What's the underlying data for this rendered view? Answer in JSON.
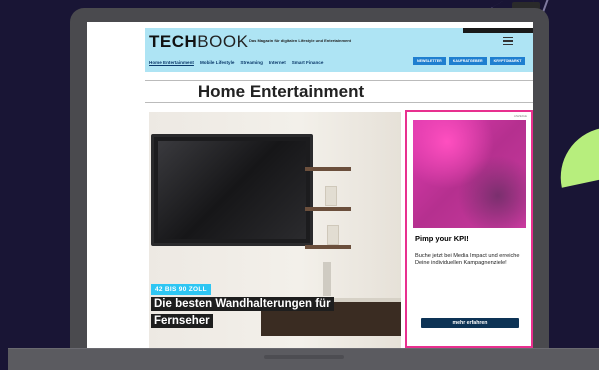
{
  "site": {
    "logo_bold": "TECH",
    "logo_light": "BOOK",
    "tagline": "Das Magazin für digitalen Lifestyle und Entertainment",
    "nav": [
      "Home Entertainment",
      "Mobile Lifestyle",
      "Streaming",
      "Internet",
      "Smart Finance"
    ],
    "header_buttons": [
      "NEWSLETTER",
      "KAUFRATGEBER",
      "KRYPTOMARKT"
    ]
  },
  "page": {
    "title": "Home Entertainment"
  },
  "hero": {
    "badge": "42 BIS 90 ZOLL",
    "title": "Die besten Wandhalterungen für Fernseher"
  },
  "ad": {
    "label": "ANZEIGE",
    "title": "Pimp your KPI!",
    "text": "Buche jetzt bei Media Impact und erreiche Deine individuellen Kampagnenziele!",
    "button": "mehr erfahren"
  },
  "colors": {
    "background": "#191535",
    "header": "#aee4f4",
    "ad_border": "#e8308f",
    "badge": "#2ec6f3",
    "accent_green": "#b7ee7d"
  }
}
